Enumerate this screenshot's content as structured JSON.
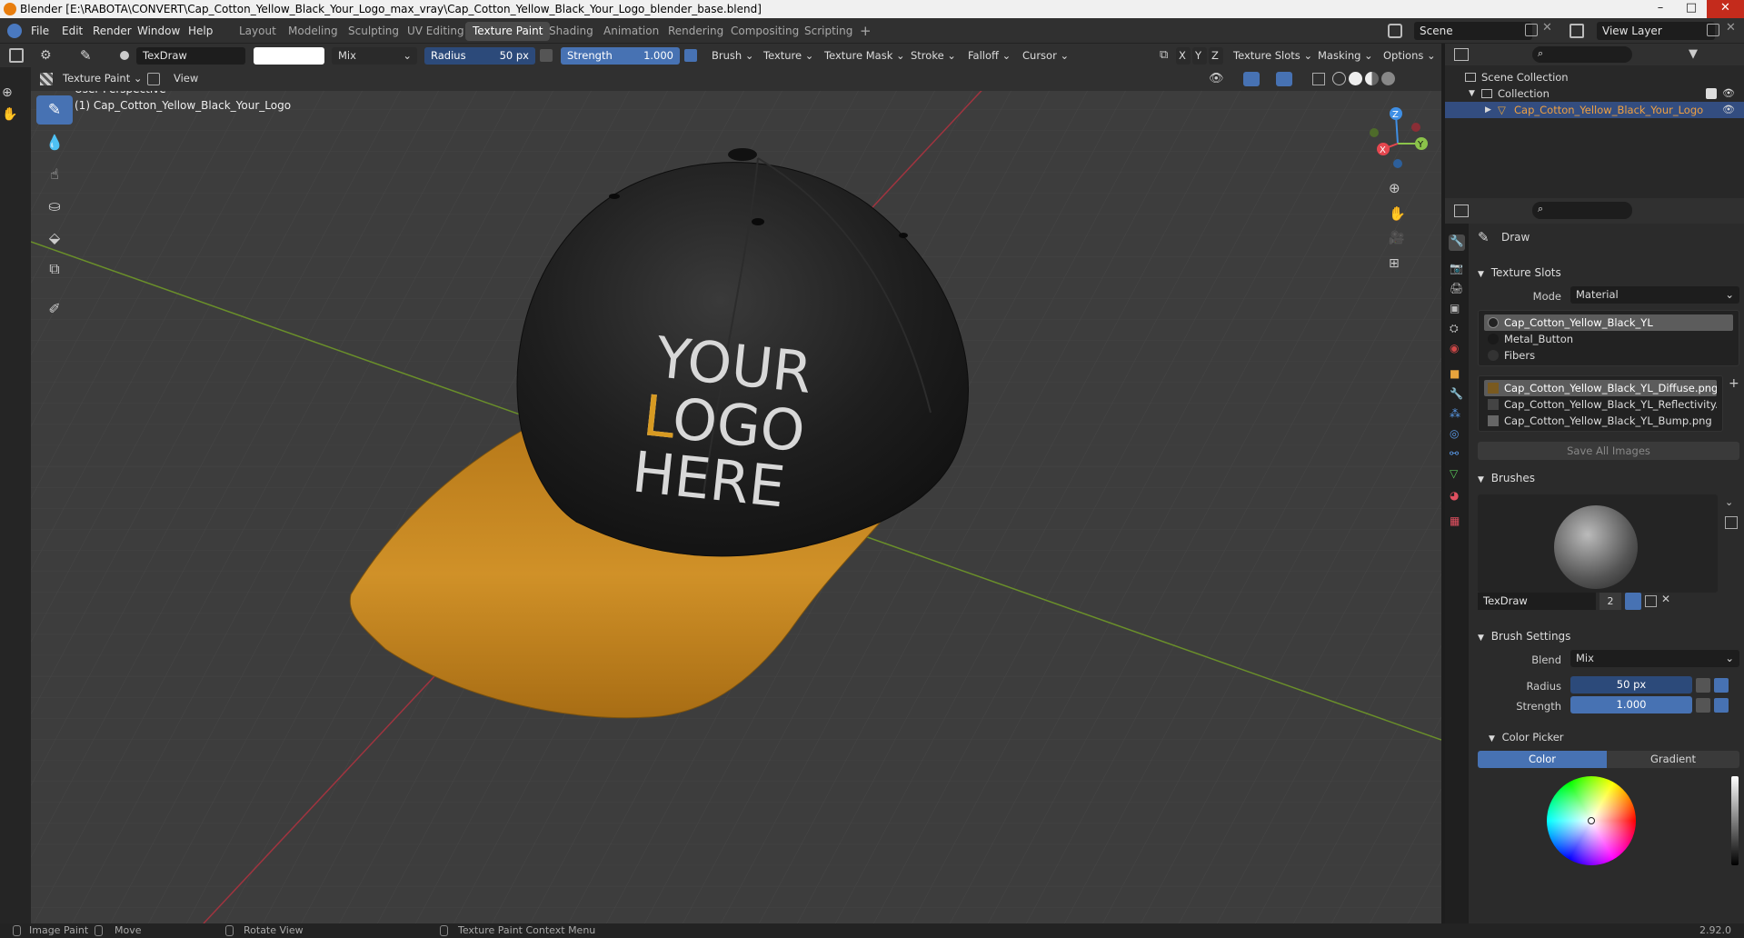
{
  "window": {
    "title": "Blender [E:\\RABOTA\\CONVERT\\Cap_Cotton_Yellow_Black_Your_Logo_max_vray\\Cap_Cotton_Yellow_Black_Your_Logo_blender_base.blend]",
    "minimize": "–",
    "maximize": "□",
    "close": "✕"
  },
  "menu": {
    "items": [
      "File",
      "Edit",
      "Render",
      "Window",
      "Help"
    ],
    "workspaces": [
      "Layout",
      "Modeling",
      "Sculpting",
      "UV Editing",
      "Texture Paint",
      "Shading",
      "Animation",
      "Rendering",
      "Compositing",
      "Scripting"
    ],
    "active_workspace": "Texture Paint",
    "add_workspace": "+",
    "scene_label": "Scene",
    "view_layer_label": "View Layer"
  },
  "tool_header": {
    "brush_name": "TexDraw",
    "blend": "Mix",
    "radius_label": "Radius",
    "radius_value": "50 px",
    "strength_label": "Strength",
    "strength_value": "1.000",
    "menus": [
      "Brush",
      "Texture",
      "Texture Mask",
      "Stroke",
      "Falloff",
      "Cursor"
    ],
    "axes": [
      "X",
      "Y",
      "Z"
    ],
    "texture_slots": "Texture Slots",
    "masking": "Masking",
    "options": "Options"
  },
  "view_header": {
    "mode": "Texture Paint",
    "view_menu": "View"
  },
  "viewport": {
    "perspective": "User Perspective",
    "object": "(1) Cap_Cotton_Yellow_Black_Your_Logo",
    "logo_lines": [
      "YOUR",
      "LOGO",
      "HERE"
    ],
    "colors": {
      "background": "#3d3d3d",
      "cap_crown": "#1c1c1c",
      "cap_brim": "#c7871c",
      "logo_text": "#d8d8d8",
      "logo_accent": "#d79a22",
      "x_axis": "#a0343f",
      "y_axis": "#6a8f2a"
    }
  },
  "gizmo": {
    "axis_labels": [
      "Z",
      "Y",
      "X"
    ],
    "colors": {
      "x": "#e5474f",
      "y": "#8bc34a",
      "z": "#3f8fe5"
    }
  },
  "outliner": {
    "scene_collection": "Scene Collection",
    "collection": "Collection",
    "object": "Cap_Cotton_Yellow_Black_Your_Logo"
  },
  "properties": {
    "tool_name": "Draw",
    "texture_slots": {
      "title": "Texture Slots",
      "mode_label": "Mode",
      "mode_value": "Material",
      "materials": [
        "Cap_Cotton_Yellow_Black_YL",
        "Metal_Button",
        "Fibers"
      ],
      "images": [
        "Cap_Cotton_Yellow_Black_YL_Diffuse.png",
        "Cap_Cotton_Yellow_Black_YL_Reflectivity....",
        "Cap_Cotton_Yellow_Black_YL_Bump.png"
      ],
      "save_all": "Save All Images"
    },
    "brushes": {
      "title": "Brushes",
      "brush_name": "TexDraw",
      "users": "2"
    },
    "brush_settings": {
      "title": "Brush Settings",
      "blend_label": "Blend",
      "blend_value": "Mix",
      "radius_label": "Radius",
      "radius_value": "50 px",
      "strength_label": "Strength",
      "strength_value": "1.000"
    },
    "color_picker": {
      "title": "Color Picker",
      "tabs": [
        "Color",
        "Gradient"
      ],
      "active_tab": "Color"
    }
  },
  "status_bar": {
    "items": [
      "Image Paint",
      "Move",
      "Rotate View",
      "Texture Paint Context Menu"
    ],
    "version": "2.92.0"
  }
}
